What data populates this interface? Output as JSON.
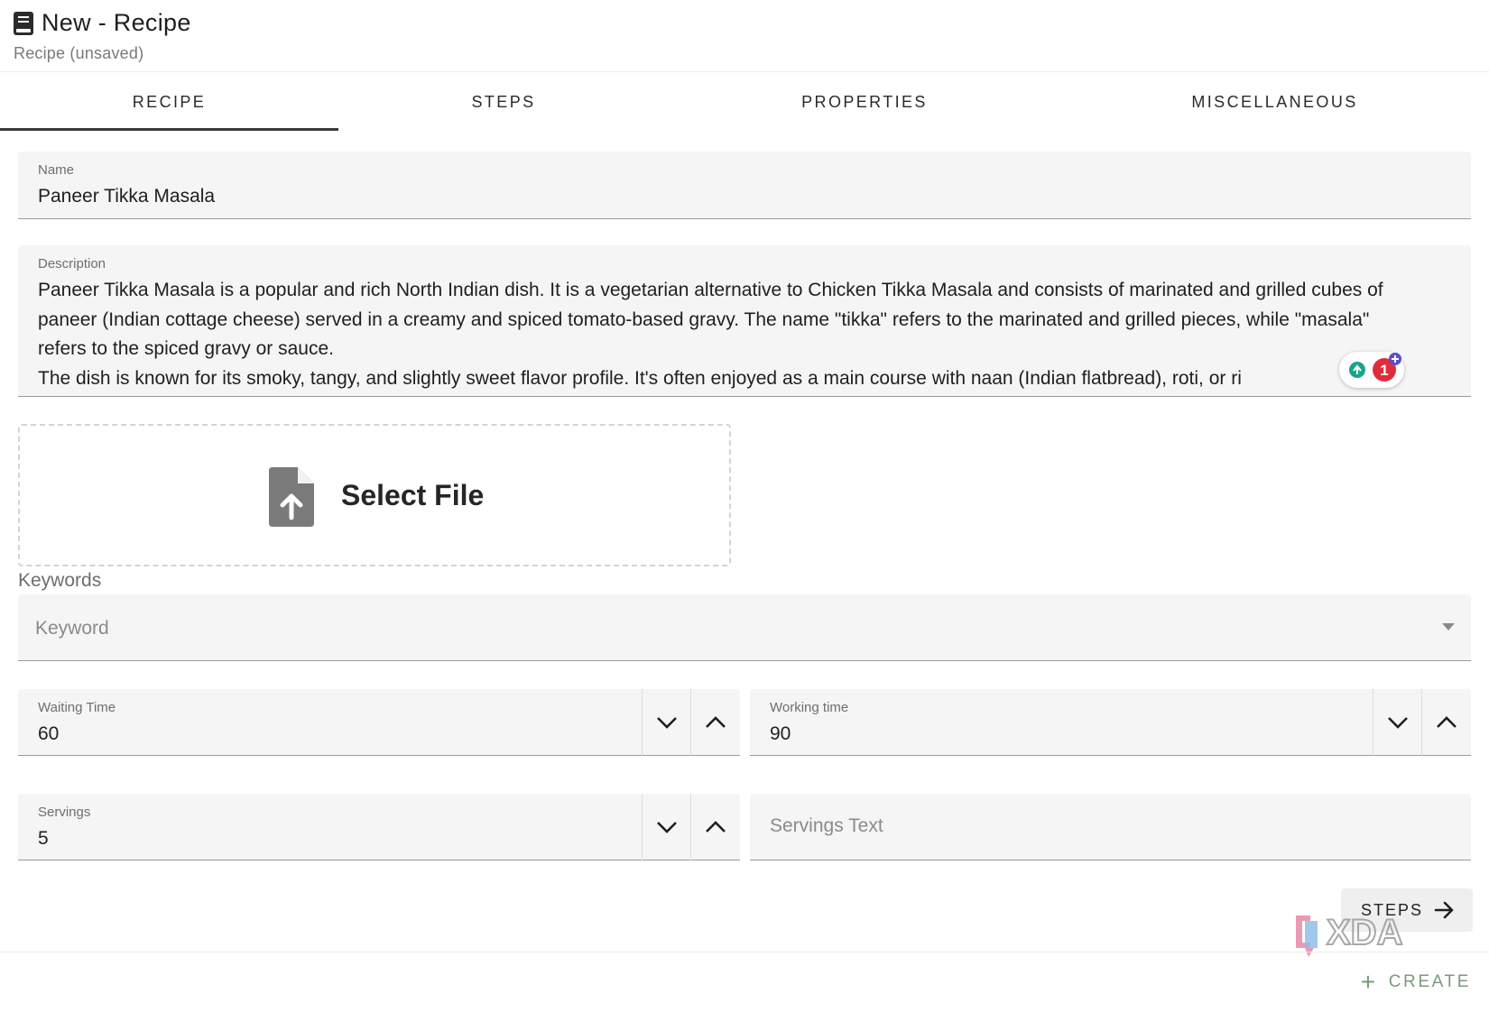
{
  "header": {
    "title": "New - Recipe",
    "subtitle": "Recipe (unsaved)",
    "icon": "book-icon"
  },
  "tabs": [
    {
      "label": "RECIPE",
      "active": true
    },
    {
      "label": "STEPS",
      "active": false
    },
    {
      "label": "PROPERTIES",
      "active": false
    },
    {
      "label": "MISCELLANEOUS",
      "active": false
    }
  ],
  "form": {
    "name": {
      "label": "Name",
      "value": "Paneer Tikka Masala"
    },
    "description": {
      "label": "Description",
      "value": "Paneer Tikka Masala is a popular and rich North Indian dish. It is a vegetarian alternative to Chicken Tikka Masala and consists of marinated and grilled cubes of paneer (Indian cottage cheese) served in a creamy and spiced tomato-based gravy. The name \"tikka\" refers to the marinated and grilled pieces, while \"masala\" refers to the spiced gravy or sauce.\nThe dish is known for its smoky, tangy, and slightly sweet flavor profile. It's often enjoyed as a main course with naan (Indian flatbread), roti, or ri"
    },
    "file_upload": {
      "label": "Select File",
      "icon": "file-upload-icon"
    },
    "keywords": {
      "section_label": "Keywords",
      "placeholder": "Keyword"
    },
    "waiting_time": {
      "label": "Waiting Time",
      "value": "60"
    },
    "working_time": {
      "label": "Working time",
      "value": "90"
    },
    "servings": {
      "label": "Servings",
      "value": "5"
    },
    "servings_text": {
      "placeholder": "Servings Text"
    }
  },
  "actions": {
    "steps_label": "STEPS",
    "create_label": "CREATE"
  },
  "grammar_widget": {
    "count": "1"
  },
  "watermark": {
    "text": "XDA"
  },
  "colors": {
    "field_bg": "#f5f5f5",
    "create_accent": "#7a9a7a",
    "grammar_teal": "#17a589",
    "grammar_red": "#e02d3c",
    "grammar_plus": "#5a4fcf"
  }
}
